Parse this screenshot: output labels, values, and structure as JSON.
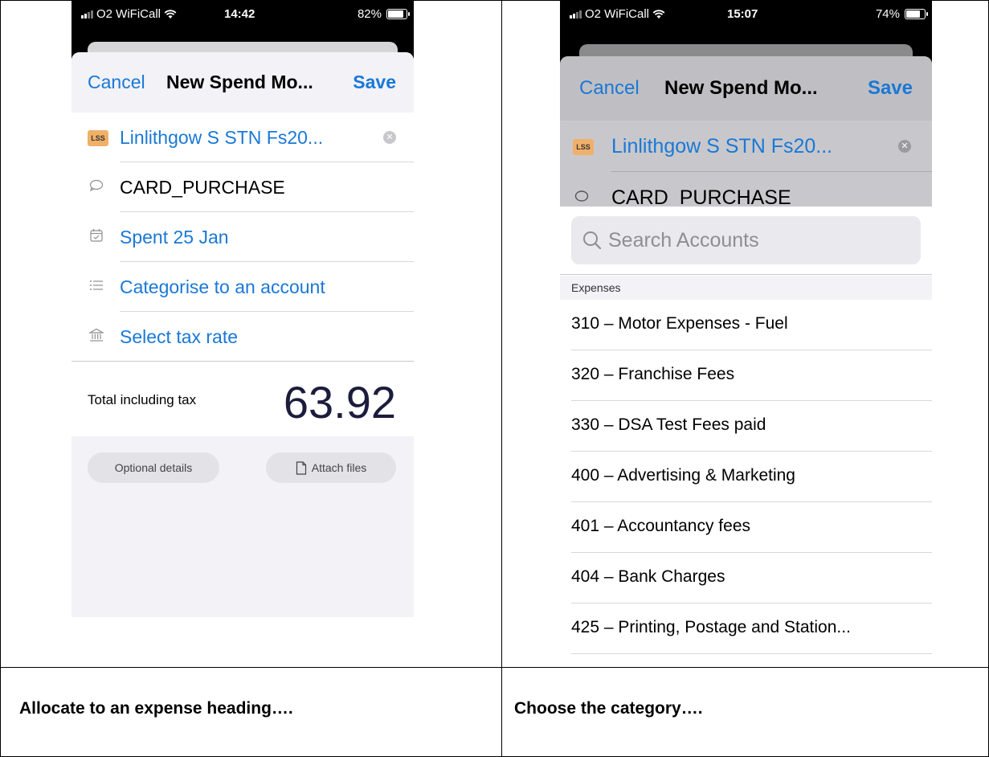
{
  "captions": {
    "left": "Allocate to an expense heading….",
    "right": "Choose the category…."
  },
  "left_phone": {
    "status": {
      "carrier": "O2 WiFiCall",
      "time": "14:42",
      "battery": "82%",
      "battery_level": 0.82
    },
    "nav": {
      "cancel": "Cancel",
      "title": "New Spend Mo...",
      "save": "Save"
    },
    "rows": {
      "contact_badge": "LSS",
      "contact": "Linlithgow S STN Fs20...",
      "reference": "CARD_PURCHASE",
      "date": "Spent 25 Jan",
      "account": "Categorise to an account",
      "tax": "Select tax rate"
    },
    "total": {
      "label": "Total including tax",
      "amount": "63.92"
    },
    "buttons": {
      "optional": "Optional details",
      "attach": "Attach files"
    }
  },
  "right_phone": {
    "status": {
      "carrier": "O2 WiFiCall",
      "time": "15:07",
      "battery": "74%",
      "battery_level": 0.74
    },
    "nav": {
      "cancel": "Cancel",
      "title": "New Spend Mo...",
      "save": "Save"
    },
    "rows": {
      "contact_badge": "LSS",
      "contact": "Linlithgow S STN Fs20...",
      "reference": "CARD_PURCHASE"
    },
    "search": {
      "placeholder": "Search Accounts"
    },
    "section": "Expenses",
    "accounts": [
      "310 – Motor Expenses - Fuel",
      "320 – Franchise Fees",
      "330 – DSA Test Fees paid",
      "400 – Advertising & Marketing",
      "401 – Accountancy fees",
      "404 – Bank Charges",
      "425 – Printing, Postage and Station..."
    ]
  }
}
